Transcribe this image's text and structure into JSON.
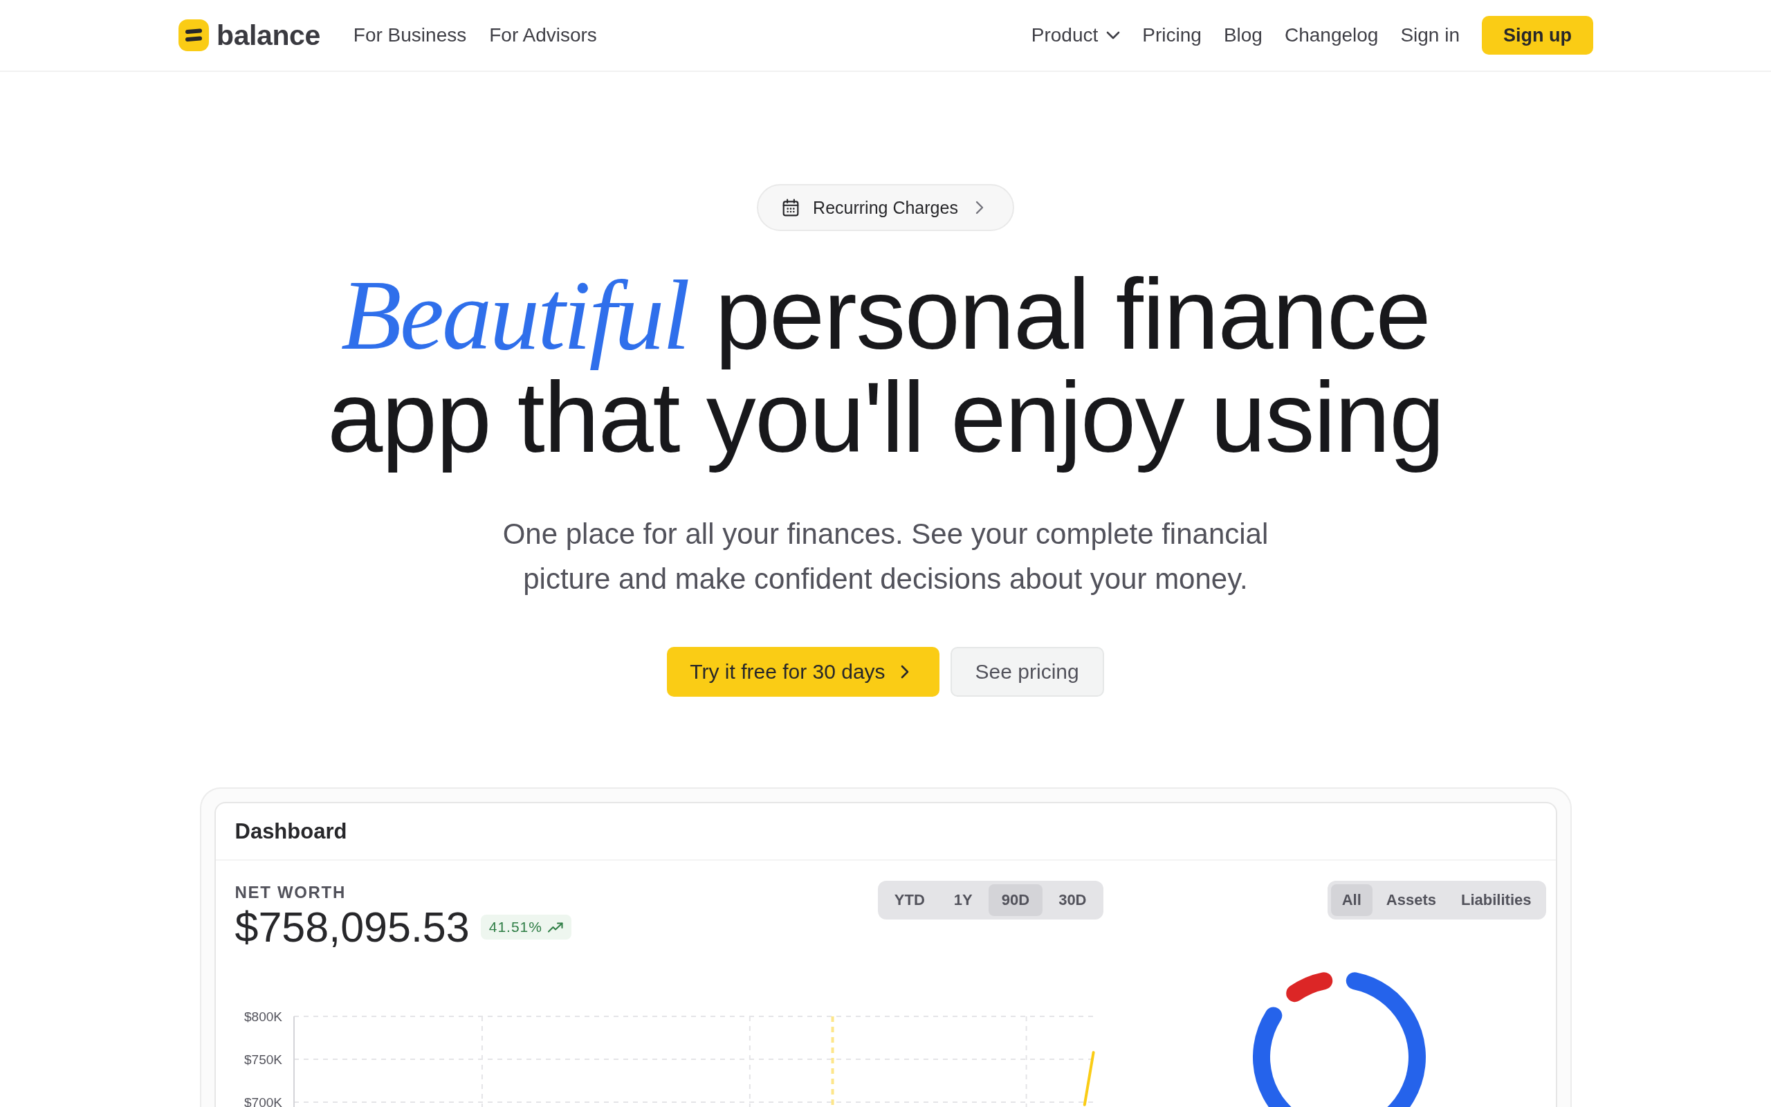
{
  "nav": {
    "brand": "balance",
    "links": [
      "For Business",
      "For Advisors"
    ],
    "right_links": [
      {
        "label": "Product",
        "kind": "dropdown"
      },
      {
        "label": "Pricing",
        "kind": "link"
      },
      {
        "label": "Blog",
        "kind": "link"
      },
      {
        "label": "Changelog",
        "kind": "link"
      },
      {
        "label": "Sign in",
        "kind": "link"
      }
    ],
    "cta": "Sign up"
  },
  "hero": {
    "announcement": "Recurring Charges",
    "headline": "*Beautiful* personal finance app that you'll enjoy using",
    "subtitle": "One place for all your finances. See your complete financial picture and make confident decisions about your money.",
    "buttons": [
      {
        "label": "Try it free for 30 days",
        "kind": "primary"
      },
      {
        "label": "See pricing",
        "kind": "secondary"
      }
    ]
  },
  "dashboard": {
    "title": "Dashboard",
    "net_worth": {
      "label": "NET WORTH",
      "value": "$758,095.53",
      "change": "41.51%"
    },
    "ranges": [
      {
        "label": "YTD",
        "selected": false
      },
      {
        "label": "1Y",
        "selected": false
      },
      {
        "label": "90D",
        "selected": true
      },
      {
        "label": "30D",
        "selected": false
      }
    ],
    "breakdown": [
      {
        "label": "All",
        "selected": true
      },
      {
        "label": "Assets",
        "selected": false
      },
      {
        "label": "Liabilities",
        "selected": false
      }
    ],
    "net_worth_chart": {
      "chart_data": {
        "type": "line",
        "categories": [
          null,
          null,
          null,
          null,
          null,
          null,
          null,
          null,
          null,
          null,
          null,
          null,
          null,
          null,
          null,
          null,
          null,
          null,
          null,
          null,
          null,
          null,
          null,
          null,
          null,
          null,
          null,
          null,
          null,
          null,
          null,
          null,
          null,
          null,
          null,
          null,
          null,
          null,
          null,
          null,
          null,
          null,
          null,
          null,
          null,
          null,
          null,
          null,
          null,
          null,
          null,
          null,
          null,
          null,
          null,
          null,
          null,
          null,
          null,
          null,
          null,
          null,
          null,
          null,
          null,
          null,
          null,
          null,
          null,
          null,
          null,
          null,
          null,
          null,
          null,
          null,
          null,
          null,
          null,
          null,
          null,
          null,
          null,
          null,
          null,
          null,
          null,
          null,
          null,
          null,
          null
        ],
        "ylim": [
          695000,
          800000
        ],
        "yticks": [
          {
            "value": 800000,
            "label": "$800K"
          },
          {
            "value": 750000,
            "label": "$750K"
          },
          {
            "value": 700000,
            "label": "$700K"
          }
        ],
        "grid": true,
        "series": [
          {
            "color": "#facc15",
            "values": [
              null,
              null,
              null,
              null,
              null,
              null,
              null,
              null,
              null,
              null,
              null,
              null,
              null,
              null,
              null,
              null,
              null,
              null,
              null,
              null,
              null,
              null,
              null,
              null,
              null,
              null,
              null,
              null,
              null,
              null,
              null,
              null,
              null,
              null,
              null,
              null,
              null,
              null,
              null,
              null,
              null,
              null,
              null,
              null,
              null,
              null,
              null,
              null,
              null,
              null,
              null,
              null,
              null,
              null,
              null,
              null,
              null,
              null,
              null,
              null,
              null,
              null,
              null,
              null,
              null,
              null,
              null,
              null,
              null,
              null,
              null,
              null,
              null,
              null,
              null,
              null,
              null,
              null,
              null,
              null,
              null,
              null,
              null,
              null,
              null,
              null,
              null,
              null,
              null,
              697000,
              758000
            ]
          }
        ]
      }
    },
    "allocation_chart": {
      "chart_data": {
        "type": "donut",
        "values": [
          90,
          10
        ],
        "colors": [
          "#2563eb",
          "#dc2626"
        ]
      }
    }
  }
}
